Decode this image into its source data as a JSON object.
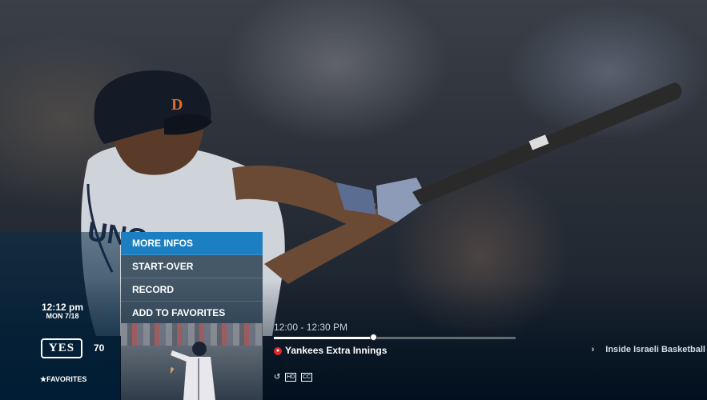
{
  "channel": {
    "time": "12:12 pm",
    "date": "MON 7/18",
    "logo_text": "YES",
    "number": "70",
    "favorites_label": "FAVORITES"
  },
  "menu": {
    "items": [
      {
        "label": "MORE INFOS",
        "active": true
      },
      {
        "label": "START-OVER",
        "active": false
      },
      {
        "label": "RECORD",
        "active": false
      },
      {
        "label": "ADD TO FAVORITES",
        "active": false
      }
    ]
  },
  "program": {
    "time_slot": "12:00 - 12:30 PM",
    "title": "Yankees Extra Innings",
    "progress": 0.41,
    "next_title": "Inside Israeli Basketball"
  },
  "icons": {
    "restart": "restart-icon",
    "hd": "HD",
    "cc": "CC"
  },
  "colors": {
    "accent": "#1b7fc2",
    "record": "#e0262b"
  }
}
